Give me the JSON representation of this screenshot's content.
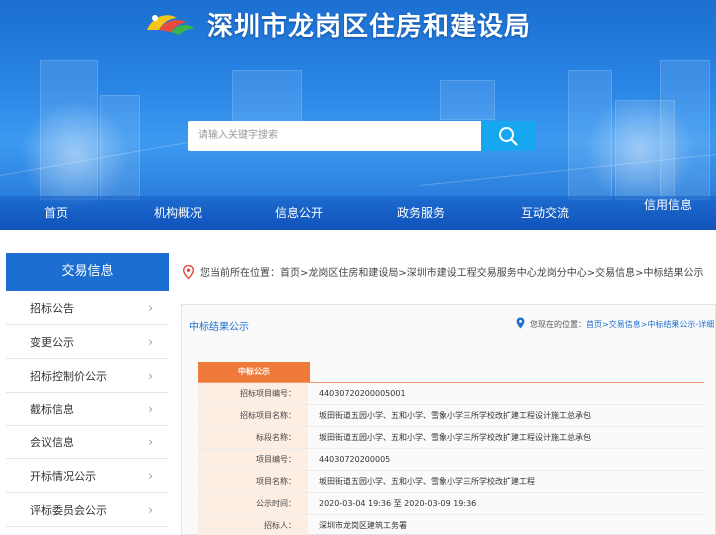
{
  "header": {
    "site_title": "深圳市龙岗区住房和建设局",
    "search_placeholder": "请输入关键字搜索"
  },
  "nav": {
    "items": [
      "首页",
      "机构概况",
      "信息公开",
      "政务服务",
      "互动交流",
      "信用信息"
    ]
  },
  "sidebar": {
    "title": "交易信息",
    "items": [
      "招标公告",
      "变更公示",
      "招标控制价公示",
      "截标信息",
      "会议信息",
      "开标情况公示",
      "评标委员会公示"
    ],
    "chevron": "›"
  },
  "breadcrumb": {
    "text": "您当前所在位置：首页>龙岗区住房和建设局>深圳市建设工程交易服务中心龙岗分中心>交易信息>中标结果公示"
  },
  "panel": {
    "title": "中标结果公示",
    "location_prefix": "您现在的位置：",
    "location_path": "首页>交易信息>中标结果公示-详细"
  },
  "notice": {
    "tag": "中标公示",
    "rows": [
      {
        "label": "招标项目编号：",
        "value": "44030720200005001"
      },
      {
        "label": "招标项目名称：",
        "value": "坂田街道五园小学、五和小学、雪象小学三所学校改扩建工程设计施工总承包"
      },
      {
        "label": "标段名称：",
        "value": "坂田街道五园小学、五和小学、雪象小学三所学校改扩建工程设计施工总承包"
      },
      {
        "label": "项目编号：",
        "value": "44030720200005"
      },
      {
        "label": "项目名称：",
        "value": "坂田街道五园小学、五和小学、雪象小学三所学校改扩建工程"
      },
      {
        "label": "公示时间：",
        "value": "2020-03-04 19:36 至 2020-03-09 19:36"
      },
      {
        "label": "招标人：",
        "value": "深圳市龙岗区建筑工务署"
      }
    ]
  },
  "colors": {
    "primary": "#1c6fd0",
    "search_button": "#16a7f0",
    "notice_tag": "#f07a3a",
    "label_bg": "#fdeee4"
  },
  "icons": {
    "search": "search-icon",
    "location": "location-pin-icon",
    "logo": "bureau-logo"
  }
}
